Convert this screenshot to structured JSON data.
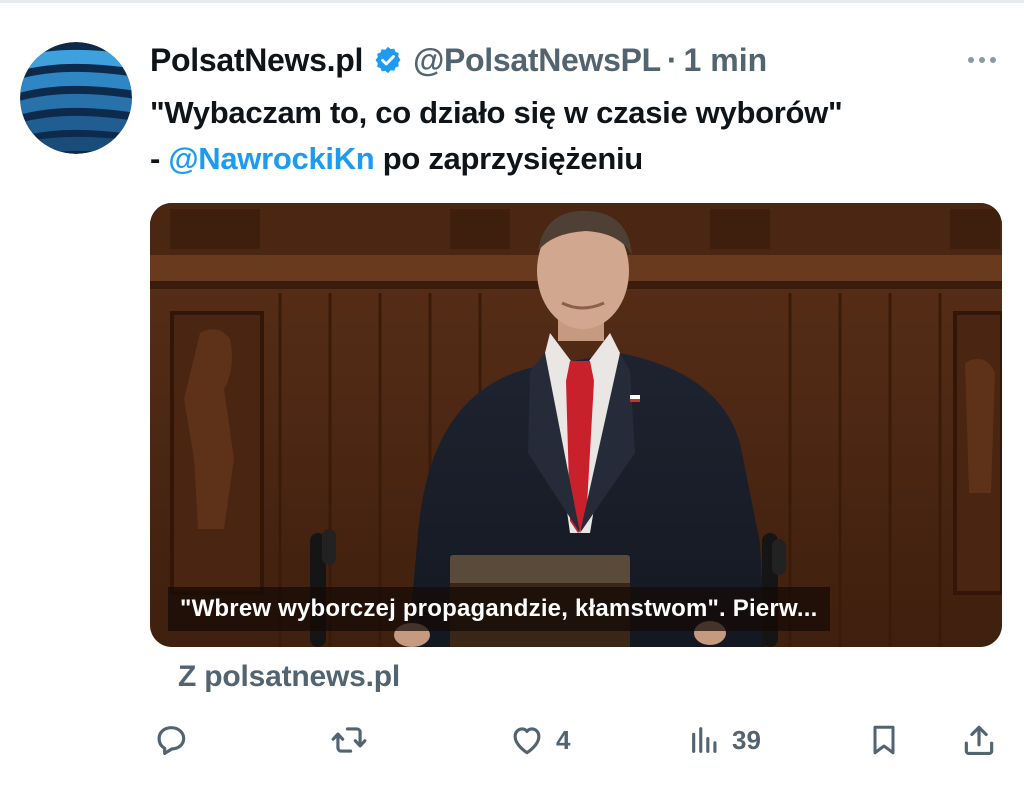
{
  "tweet": {
    "author": {
      "display_name": "PolsatNews.pl",
      "handle": "@PolsatNewsPL",
      "verified": true,
      "avatar_icon": "polsat-news-globe-logo"
    },
    "separator": "·",
    "time": "1 min",
    "text": {
      "line1": "\"Wybaczam to, co działo się w czasie wyborów\"",
      "dash": "- ",
      "mention": "@NawrockiKn",
      "rest": " po zaprzysiężeniu"
    },
    "media": {
      "caption": "\"Wbrew wyborczej propagandzie, kłamstwom\". Pierw...",
      "source_label": "Z polsatnews.pl"
    },
    "actions": {
      "reply_count": "",
      "retweet_count": "",
      "like_count": "4",
      "views_count": "39"
    }
  },
  "colors": {
    "text_primary": "#0f1419",
    "text_secondary": "#536471",
    "link_blue": "#1d9bf0",
    "verified_blue": "#1d9bf0"
  }
}
